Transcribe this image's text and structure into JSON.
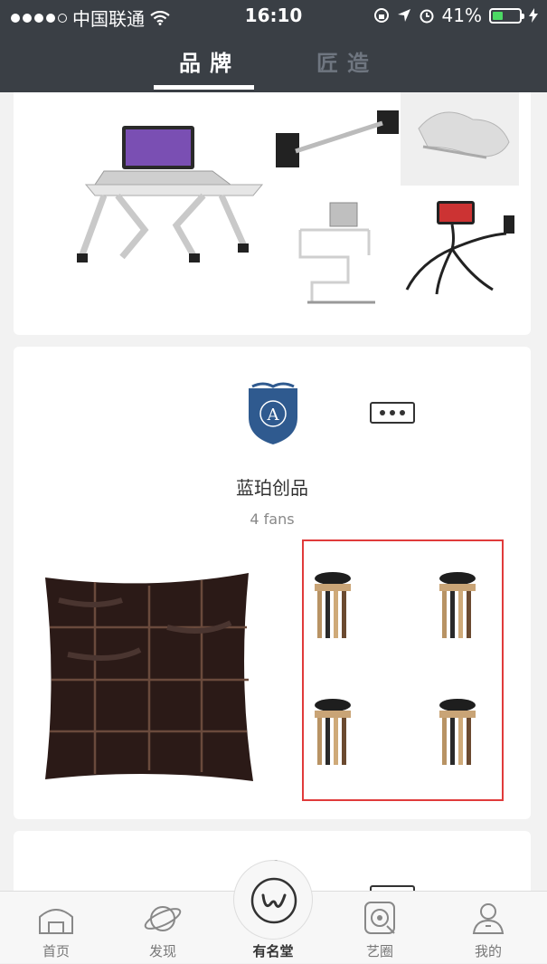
{
  "status": {
    "carrier": "中国联通",
    "time": "16:10",
    "battery": "41%",
    "battery_level": 0.41
  },
  "tabs": [
    {
      "label": "品牌",
      "active": true
    },
    {
      "label": "匠造",
      "active": false
    }
  ],
  "brand": {
    "name": "蓝珀创品",
    "fans": "4 fans",
    "logo_letter": "A"
  },
  "tabbar": [
    {
      "label": "首页",
      "icon": "home-icon"
    },
    {
      "label": "发现",
      "icon": "planet-icon"
    },
    {
      "label": "有名堂",
      "icon": "w-logo-icon"
    },
    {
      "label": "艺圈",
      "icon": "circle-icon"
    },
    {
      "label": "我的",
      "icon": "user-icon"
    }
  ],
  "colors": {
    "header": "#3a3f45",
    "highlight": "#e03b3b",
    "battery": "#4cd964"
  }
}
